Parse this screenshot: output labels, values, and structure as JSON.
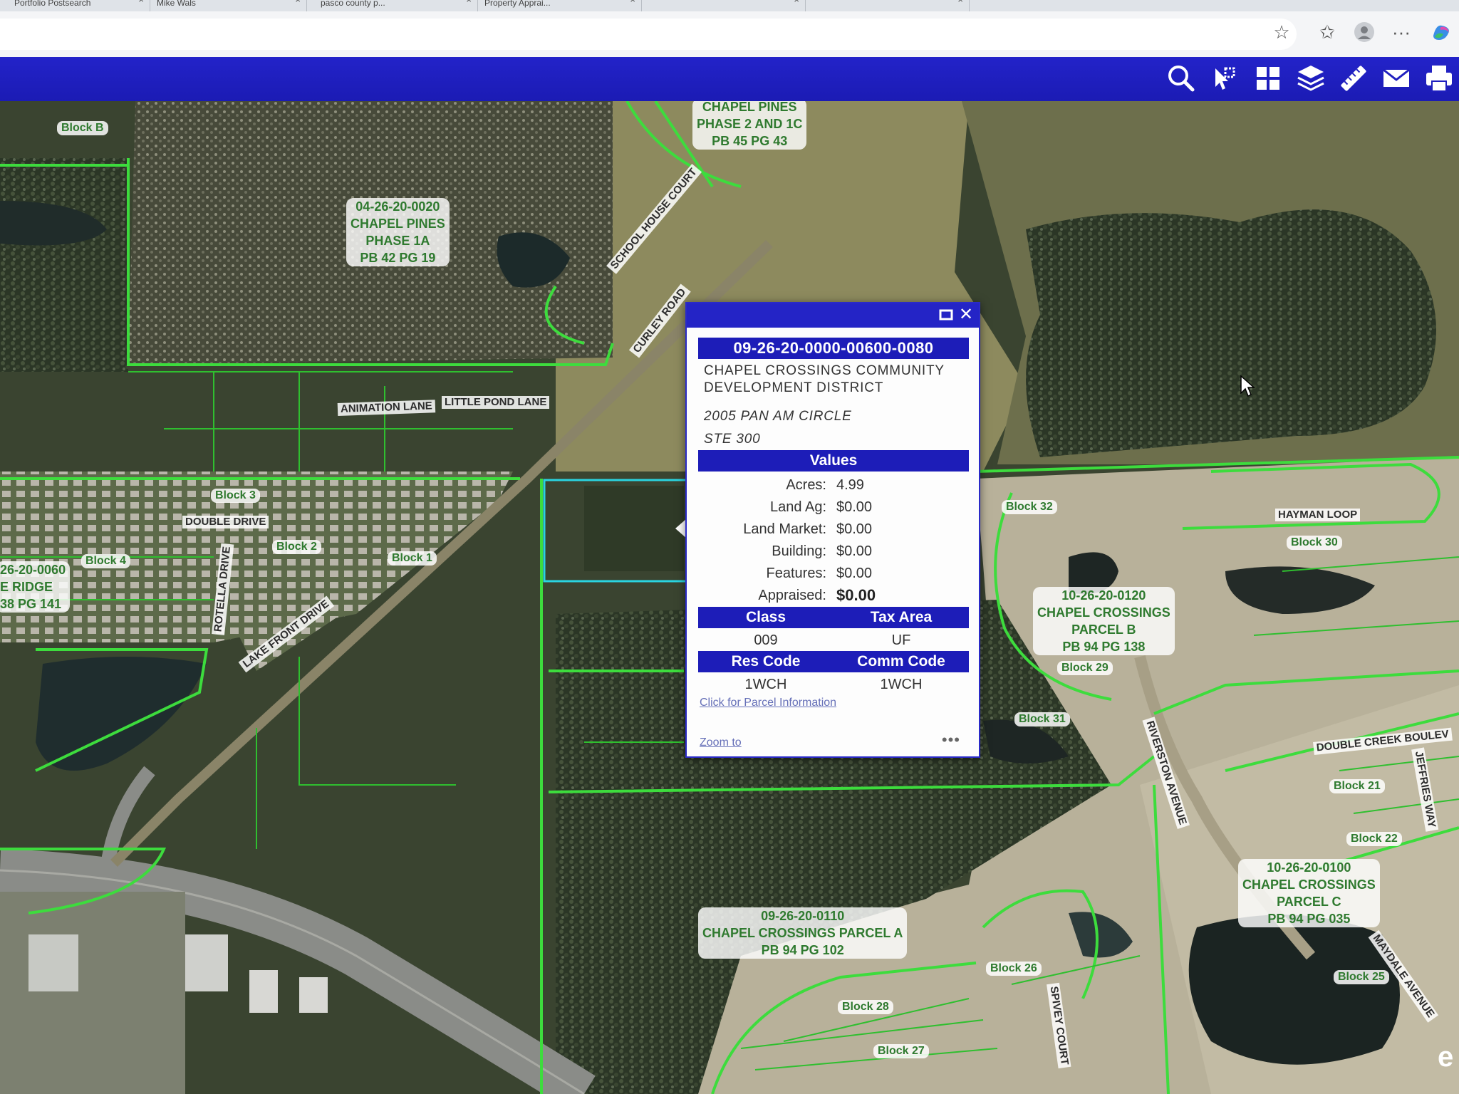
{
  "browser": {
    "tabs": [
      {
        "label": "Portfolio Postsearch"
      },
      {
        "label": "Mike Wals"
      },
      {
        "label": "pasco county p..."
      },
      {
        "label": "Property Apprai..."
      },
      {
        "label": ""
      },
      {
        "label": ""
      }
    ],
    "icons": [
      "star-add-icon",
      "favorites-icon",
      "profile-icon",
      "more-icon",
      "copilot-icon"
    ]
  },
  "toolbar": {
    "tools": [
      "search-icon",
      "select-parcel-icon",
      "basemap-grid-icon",
      "layers-icon",
      "measure-icon",
      "email-icon",
      "print-icon"
    ]
  },
  "map": {
    "parcel_labels": [
      {
        "lines": [
          "CHAPEL PINES",
          "PHASE 2 AND 1C",
          "PB 45 PG 43"
        ]
      },
      {
        "lines": [
          "04-26-20-0020",
          "CHAPEL PINES",
          "PHASE 1A",
          "PB 42 PG 19"
        ]
      },
      {
        "lines": [
          "26-20-0060",
          "E RIDGE",
          "38 PG 141"
        ]
      },
      {
        "lines": [
          "10-26-20-0120",
          "CHAPEL CROSSINGS",
          "PARCEL B",
          "PB 94 PG 138"
        ]
      },
      {
        "lines": [
          "10-26-20-0100",
          "CHAPEL CROSSINGS",
          "PARCEL C",
          "PB 94 PG 035"
        ]
      },
      {
        "lines": [
          "09-26-20-0110",
          "CHAPEL CROSSINGS PARCEL A",
          "PB 94 PG 102"
        ]
      }
    ],
    "roads": [
      "SCHOOL HOUSE COURT",
      "CURLEY ROAD",
      "ANIMATION LANE",
      "LITTLE POND LANE",
      "DOUBLE DRIVE",
      "ROTELLA DRIVE",
      "LAKE FRONT DRIVE",
      "HAYMAN LOOP",
      "RIVERSTON AVENUE",
      "DOUBLE CREEK BOULEV",
      "JEFFRIES WAY",
      "MAYDALE AVENUE",
      "SPIVEY COURT"
    ],
    "blocks": [
      "Block B",
      "Block 3",
      "Block 2",
      "Block 4",
      "Block 1",
      "Block 32",
      "Block 30",
      "Block 29",
      "Block 31",
      "Block 21",
      "Block 22",
      "Block 25",
      "Block 26",
      "Block 28",
      "Block 27"
    ]
  },
  "popup": {
    "parcel_id": "09-26-20-0000-00600-0080",
    "owner_line1": "CHAPEL CROSSINGS COMMUNITY",
    "owner_line2": "DEVELOPMENT DISTRICT",
    "address_line1": "2005 PAN AM CIRCLE",
    "address_line2": "STE 300",
    "values_header": "Values",
    "values": [
      {
        "label": "Acres:",
        "value": "4.99"
      },
      {
        "label": "Land Ag:",
        "value": "$0.00"
      },
      {
        "label": "Land Market:",
        "value": "$0.00"
      },
      {
        "label": "Building:",
        "value": "$0.00"
      },
      {
        "label": "Features:",
        "value": "$0.00"
      },
      {
        "label": "Appraised:",
        "value": "$0.00"
      }
    ],
    "class_header": "Class",
    "tax_area_header": "Tax Area",
    "class_value": "009",
    "tax_area_value": "UF",
    "res_code_header": "Res Code",
    "comm_code_header": "Comm Code",
    "res_code_value": "1WCH",
    "comm_code_value": "1WCH",
    "parcel_link": "Click for Parcel Information",
    "zoom_link": "Zoom to",
    "more": "•••"
  },
  "colors": {
    "toolbar": "#1f1fbf",
    "parcel_line": "#3ddc3d",
    "selected_parcel": "#2ad4e0",
    "popup_header": "#1d1db8"
  }
}
